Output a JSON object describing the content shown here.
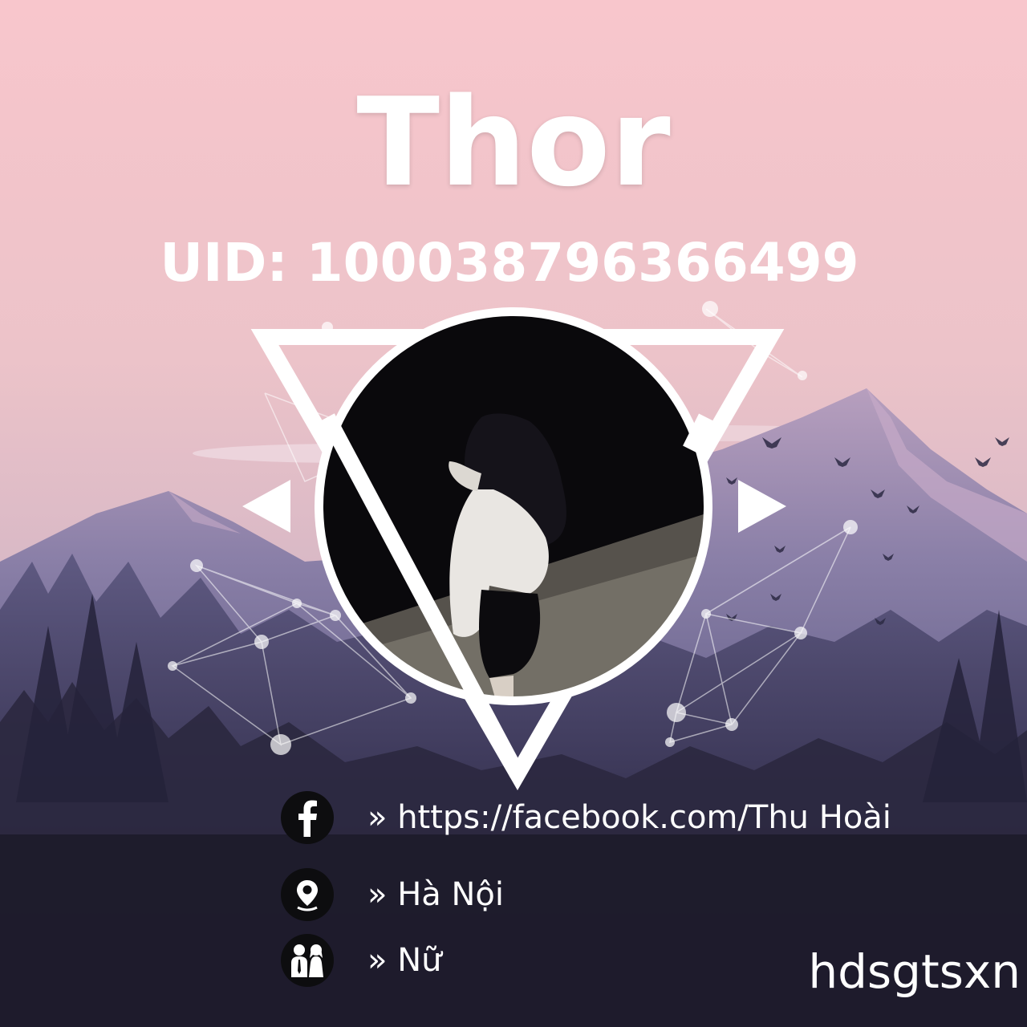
{
  "card": {
    "name": "Thor",
    "uid": "UID: 100038796366499"
  },
  "info": {
    "facebook": "» https://facebook.com/Thu Hoài",
    "location": "» Hà Nội",
    "gender": "» Nữ"
  },
  "watermark": "hdsgtsxn",
  "icons": {
    "facebook": "facebook-icon",
    "location": "location-pin-icon",
    "gender": "gender-couple-icon"
  },
  "colors": {
    "sky_top": "#f7c5cb",
    "sky_mid": "#e6c0c9",
    "mountain": "#8c7fa8",
    "forest": "#3e3a5a",
    "ground": "#1d1b2b",
    "frame": "#ffffff"
  }
}
